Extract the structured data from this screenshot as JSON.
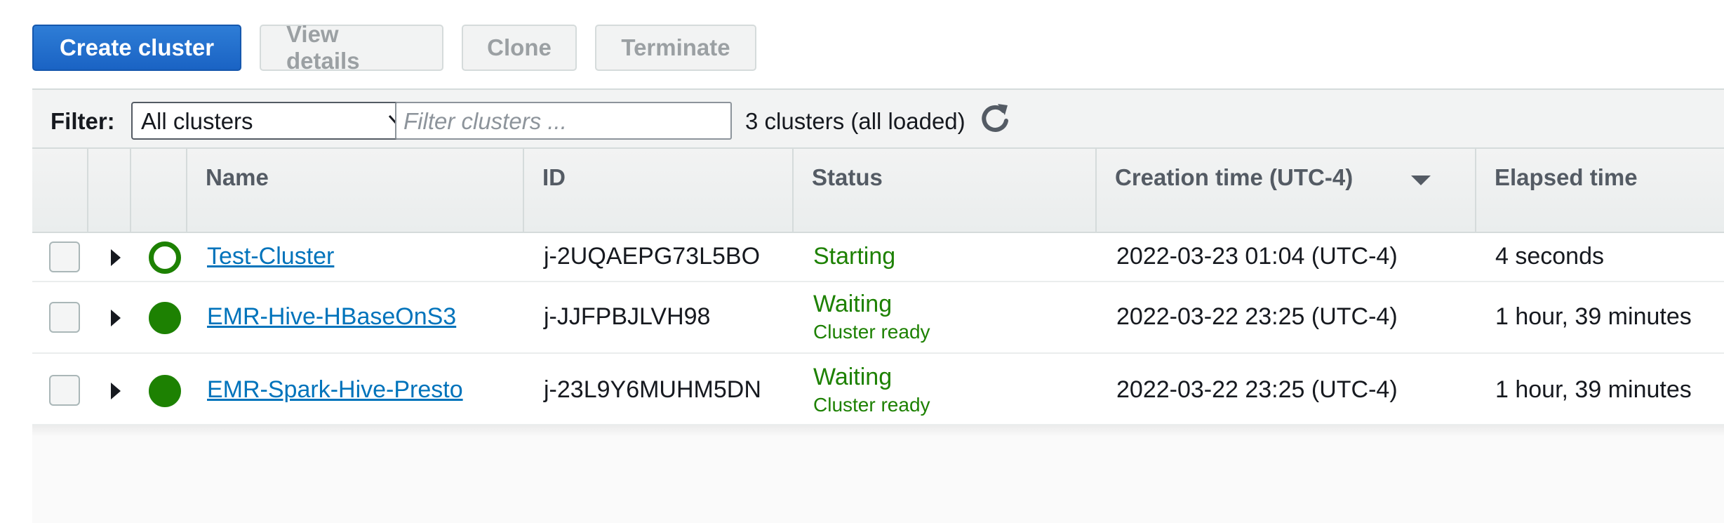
{
  "toolbar": {
    "create_label": "Create cluster",
    "view_details_label": "View details",
    "clone_label": "Clone",
    "terminate_label": "Terminate"
  },
  "filter": {
    "label": "Filter:",
    "selected": "All clusters",
    "placeholder": "Filter clusters ...",
    "count_text": "3 clusters (all loaded)"
  },
  "columns": {
    "name": "Name",
    "id": "ID",
    "status": "Status",
    "creation_time": "Creation time (UTC-4)",
    "elapsed_time": "Elapsed time"
  },
  "clusters": [
    {
      "name": "Test-Cluster",
      "id": "j-2UQAEPG73L5BO",
      "status": "Starting",
      "status_detail": "",
      "status_icon": "status-starting-icon",
      "creation_time": "2022-03-23 01:04 (UTC-4)",
      "elapsed": "4 seconds"
    },
    {
      "name": "EMR-Hive-HBaseOnS3",
      "id": "j-JJFPBJLVH98",
      "status": "Waiting",
      "status_detail": "Cluster ready",
      "status_icon": "status-waiting-icon",
      "creation_time": "2022-03-22 23:25 (UTC-4)",
      "elapsed": "1 hour, 39 minutes"
    },
    {
      "name": "EMR-Spark-Hive-Presto",
      "id": "j-23L9Y6MUHM5DN",
      "status": "Waiting",
      "status_detail": "Cluster ready",
      "status_icon": "status-waiting-icon",
      "creation_time": "2022-03-22 23:25 (UTC-4)",
      "elapsed": "1 hour, 39 minutes"
    }
  ],
  "colors": {
    "primary": "#1a63c4",
    "link": "#0073bb",
    "status_green": "#1d8102"
  }
}
